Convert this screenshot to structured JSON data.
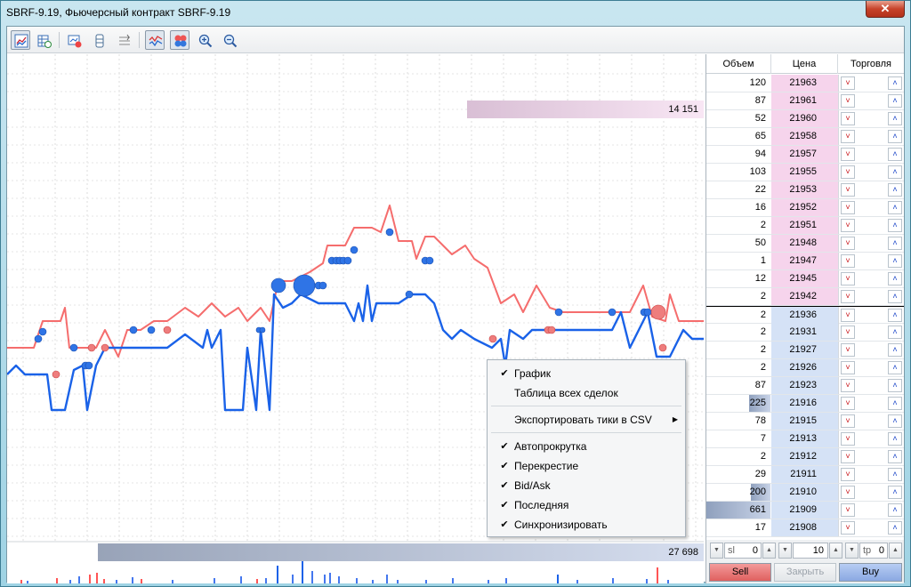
{
  "window": {
    "title": "SBRF-9.19, Фьючерсный контракт SBRF-9.19",
    "close_glyph": "✕"
  },
  "toolbar": {
    "icons": [
      "chart-view-icon",
      "ticks-table-icon",
      "export-icon",
      "autoscroll-icon",
      "crosshair-icon",
      "bid-ask-icon",
      "last-price-icon",
      "zoom-in-icon",
      "zoom-out-icon"
    ]
  },
  "chart": {
    "ask_volume_label": "14 151",
    "bid_volume_label": "27 698",
    "ask_volume_share": 0.34,
    "bid_volume_share": 0.87,
    "colors": {
      "ask": "#f56d6d",
      "bid": "#1a62e8",
      "ask_dot": "#ee7d7d",
      "bid_dot": "#2f74e6"
    }
  },
  "context_menu": {
    "items": [
      {
        "label": "График",
        "checked": true
      },
      {
        "label": "Таблица всех сделок",
        "checked": false
      },
      {
        "label": "Экспортировать тики в CSV",
        "checked": false,
        "submenu": true
      },
      {
        "label": "Автопрокрутка",
        "checked": true
      },
      {
        "label": "Перекрестие",
        "checked": true
      },
      {
        "label": "Bid/Ask",
        "checked": true
      },
      {
        "label": "Последняя",
        "checked": true
      },
      {
        "label": "Синхронизировать",
        "checked": true
      }
    ],
    "check_glyph": "✔",
    "arrow_glyph": "▶"
  },
  "book": {
    "headers": {
      "volume": "Объем",
      "price": "Цена",
      "trade": "Торговля"
    },
    "sell_glyph": "˅",
    "buy_glyph": "˄",
    "rows": [
      {
        "volume": "120",
        "price": "21963",
        "side": "ask"
      },
      {
        "volume": "87",
        "price": "21961",
        "side": "ask"
      },
      {
        "volume": "52",
        "price": "21960",
        "side": "ask"
      },
      {
        "volume": "65",
        "price": "21958",
        "side": "ask"
      },
      {
        "volume": "94",
        "price": "21957",
        "side": "ask"
      },
      {
        "volume": "103",
        "price": "21955",
        "side": "ask"
      },
      {
        "volume": "22",
        "price": "21953",
        "side": "ask"
      },
      {
        "volume": "16",
        "price": "21952",
        "side": "ask"
      },
      {
        "volume": "2",
        "price": "21951",
        "side": "ask"
      },
      {
        "volume": "50",
        "price": "21948",
        "side": "ask"
      },
      {
        "volume": "1",
        "price": "21947",
        "side": "ask"
      },
      {
        "volume": "12",
        "price": "21945",
        "side": "ask"
      },
      {
        "volume": "2",
        "price": "21942",
        "side": "ask"
      },
      {
        "volume": "2",
        "price": "21936",
        "side": "bid"
      },
      {
        "volume": "2",
        "price": "21931",
        "side": "bid"
      },
      {
        "volume": "2",
        "price": "21927",
        "side": "bid"
      },
      {
        "volume": "2",
        "price": "21926",
        "side": "bid"
      },
      {
        "volume": "87",
        "price": "21923",
        "side": "bid"
      },
      {
        "volume": "225",
        "price": "21916",
        "side": "bid",
        "bar_share": 0.33
      },
      {
        "volume": "78",
        "price": "21915",
        "side": "bid"
      },
      {
        "volume": "7",
        "price": "21913",
        "side": "bid"
      },
      {
        "volume": "2",
        "price": "21912",
        "side": "bid"
      },
      {
        "volume": "29",
        "price": "21911",
        "side": "bid"
      },
      {
        "volume": "200",
        "price": "21910",
        "side": "bid",
        "bar_share": 0.3
      },
      {
        "volume": "661",
        "price": "21909",
        "side": "bid",
        "bar_share": 1.0
      },
      {
        "volume": "17",
        "price": "21908",
        "side": "bid"
      }
    ]
  },
  "order_panel": {
    "sl_label": "sl",
    "sl_value": "0",
    "volume_value": "10",
    "tp_label": "tp",
    "tp_value": "0",
    "down_glyph": "▼",
    "up_glyph": "▲",
    "sell_label": "Sell",
    "close_label": "Закрыть",
    "buy_label": "Buy"
  }
}
